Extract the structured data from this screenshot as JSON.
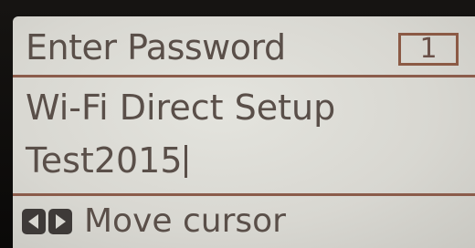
{
  "screen": {
    "title": "Enter Password",
    "counter": "1",
    "field_label": "Wi-Fi Direct Setup",
    "field_value": "Test2015",
    "hint": {
      "icons": [
        "left-arrow-key-icon",
        "right-arrow-key-icon"
      ],
      "text": "Move cursor"
    }
  },
  "colors": {
    "lcd_background": "#d8d7d1",
    "text": "#5a4f49",
    "divider": "#8b5c4b",
    "key_icon": "#3e3a38"
  }
}
